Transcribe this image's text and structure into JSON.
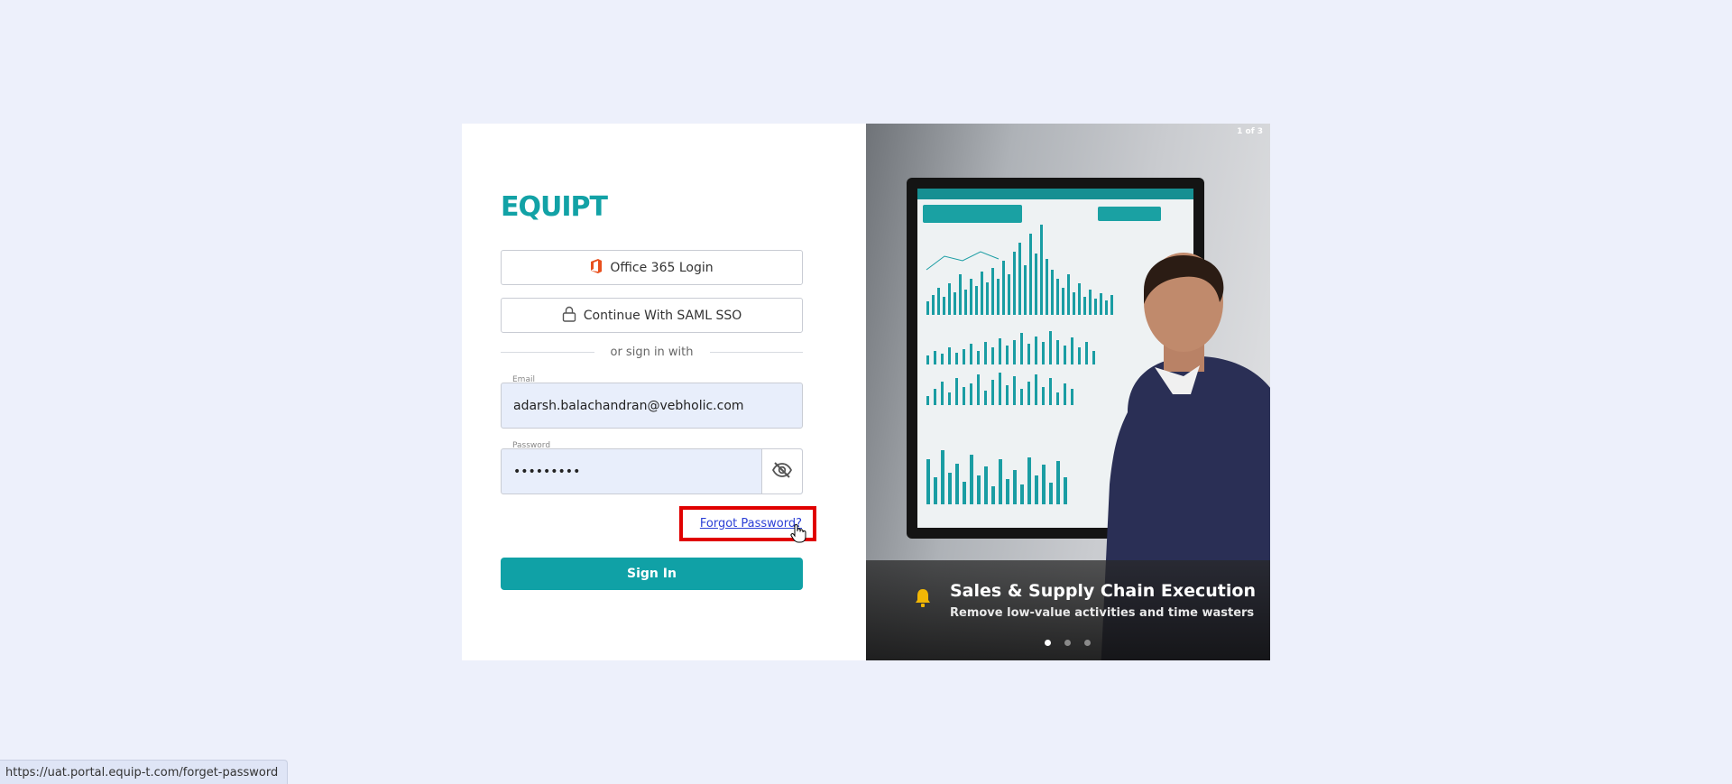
{
  "brand": {
    "logo_text": "EQUIPT",
    "accent_color": "#10a1a6"
  },
  "login": {
    "office_label": "Office 365 Login",
    "office_icon": "office365-icon",
    "saml_label": "Continue With SAML SSO",
    "saml_icon": "lock-icon",
    "divider_text": "or sign in with",
    "email": {
      "label": "Email",
      "value": "adarsh.balachandran@vebholic.com"
    },
    "password": {
      "label": "Password",
      "value": "•••••••••",
      "toggle_icon": "eye-slash-icon"
    },
    "forgot_label": "Forgot Password?",
    "signin_label": "Sign In"
  },
  "carousel": {
    "counter": "1 of 3",
    "title": "Sales & Supply Chain Execution",
    "subtitle": "Remove low-value activities and time wasters",
    "icon": "bell-icon",
    "active_slide": 1,
    "slides_total": 3
  },
  "status_bar": {
    "url": "https://uat.portal.equip-t.com/forget-password"
  },
  "highlight_color": "#e00000"
}
